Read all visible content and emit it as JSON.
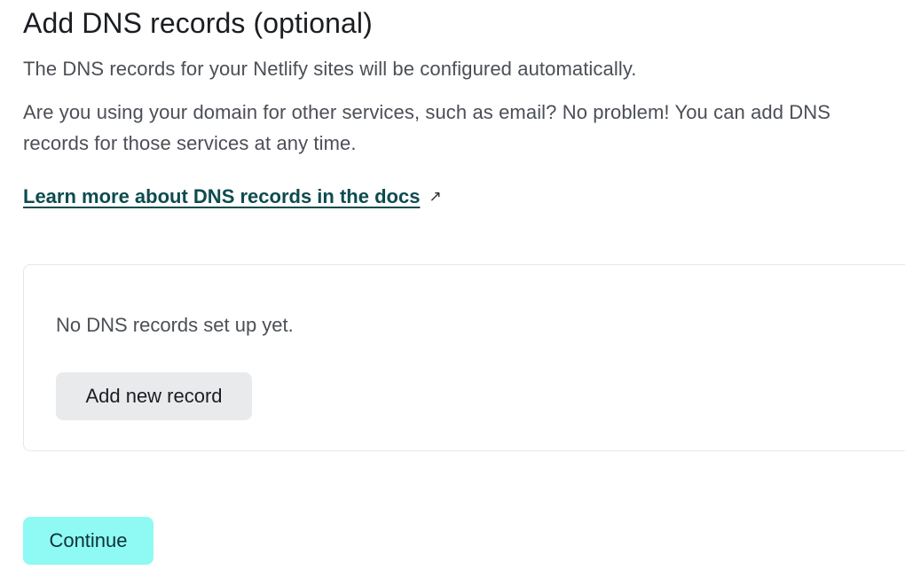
{
  "header": {
    "title": "Add DNS records (optional)"
  },
  "intro": {
    "line1": "The DNS records for your Netlify sites will be configured automatically.",
    "line2": "Are you using your domain for other services, such as email? No problem! You can add DNS records for those services at any time."
  },
  "docs_link": {
    "label": "Learn more about DNS records in the docs",
    "icon": "external-link-icon",
    "glyph": "↗"
  },
  "records_card": {
    "empty_message": "No DNS records set up yet.",
    "add_button_label": "Add new record"
  },
  "footer": {
    "continue_label": "Continue"
  },
  "colors": {
    "link": "#0d4b4f",
    "continue_bg": "#8ff9f3",
    "secondary_button_bg": "#e9eaec",
    "body_text": "#4b4f56"
  }
}
